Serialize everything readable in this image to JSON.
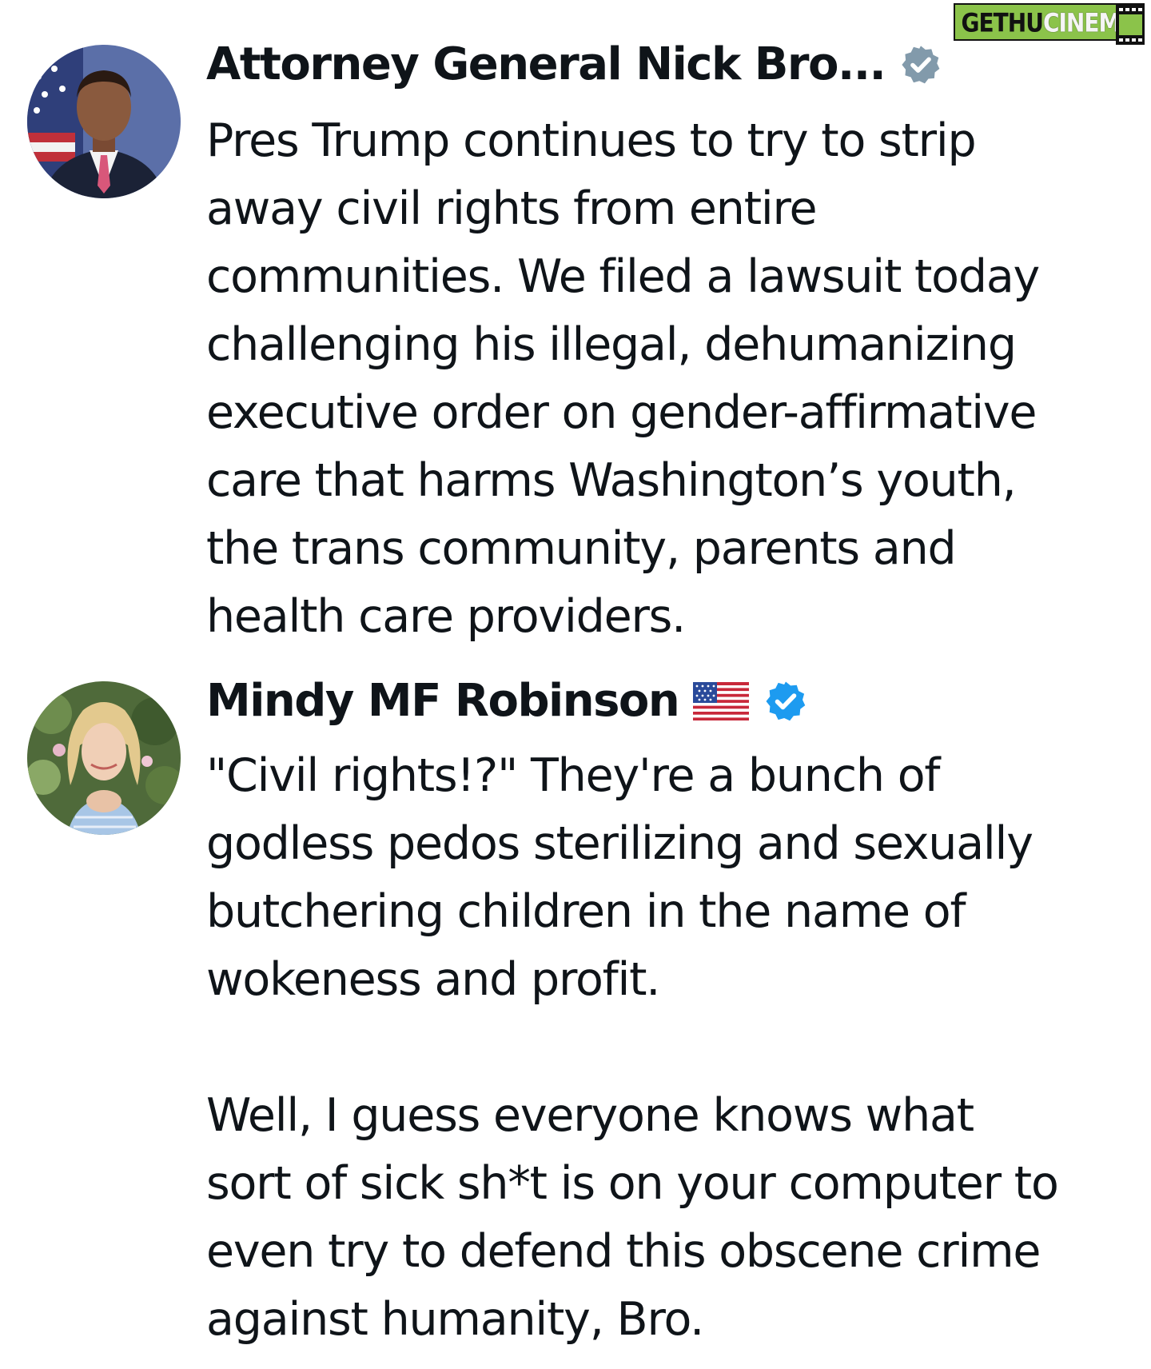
{
  "watermark": {
    "part_a": "GETHU",
    "part_b": "CINEMA"
  },
  "tweets": [
    {
      "author_name": "Attorney General Nick Bro...",
      "verified": true,
      "badge_color": "#829aab",
      "avatar_icon": "man-portrait-with-flag",
      "text": "Pres Trump continues to try to strip\naway civil rights from entire\ncommunities. We filed a lawsuit today\nchallenging his illegal, dehumanizing\nexecutive order on gender-affirmative\ncare that harms Washington’s youth,\nthe trans community, parents and\nhealth care providers."
    },
    {
      "author_name": "Mindy MF Robinson",
      "flag_emoji": "us-flag",
      "verified": true,
      "badge_color": "#1d9bf0",
      "avatar_icon": "woman-portrait-outdoors",
      "text": "\"Civil rights!?\" They're a bunch of\ngodless pedos sterilizing and sexually\nbutchering children in the name of\nwokeness and profit.\n\nWell, I guess everyone knows what\nsort of sick sh*t is on your computer to\neven try to defend this obscene crime\nagainst humanity, Bro."
    }
  ],
  "colors": {
    "text": "#0f1419",
    "background": "#ffffff"
  }
}
